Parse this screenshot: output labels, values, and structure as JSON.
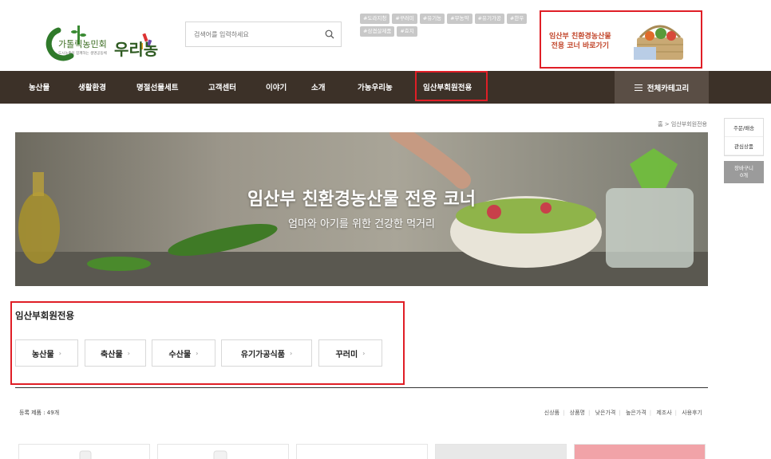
{
  "logo": {
    "main_text": "가톨릭농민회",
    "sub_text": "도시농촌이 함께하는 생명공동체",
    "brand": "우리농"
  },
  "search": {
    "placeholder": "검색어를 입력하세요"
  },
  "tags": [
    "#도라지청",
    "#꾸러미",
    "#유기농",
    "#무농약",
    "#유기가공",
    "#한우",
    "#삼겹살제품",
    "#효지"
  ],
  "promo": {
    "line1": "임산부 친환경농산물",
    "line2": "전용 코너 바로가기"
  },
  "nav": {
    "items": [
      "농산물",
      "생활환경",
      "명절선물세트",
      "고객센터",
      "이야기",
      "소개",
      "가농우리농",
      "임산부회원전용"
    ],
    "all_label": "전체카테고리"
  },
  "quick_menu": {
    "items": [
      "주문/배송",
      "관심상품"
    ],
    "cart_label": "장바구니",
    "cart_count": "0개"
  },
  "breadcrumb": {
    "home": "홈",
    "sep": ">",
    "current": "임산부회원전용"
  },
  "hero": {
    "title": "임산부 친환경농산물 전용 코너",
    "subtitle": "엄마와 아기를 위한 건강한 먹거리"
  },
  "category": {
    "title": "임산부회원전용",
    "buttons": [
      "농산물",
      "축산물",
      "수산물",
      "유기가공식품",
      "꾸러미"
    ]
  },
  "listing": {
    "count_label": "등록 제품 : 49개",
    "sorts": [
      "신상품",
      "상품명",
      "낮은가격",
      "높은가격",
      "제조사",
      "사용후기"
    ]
  },
  "colors": {
    "nav_bg": "#3c3128",
    "highlight": "#e01e26",
    "tag_bg": "#c8c8c8"
  }
}
